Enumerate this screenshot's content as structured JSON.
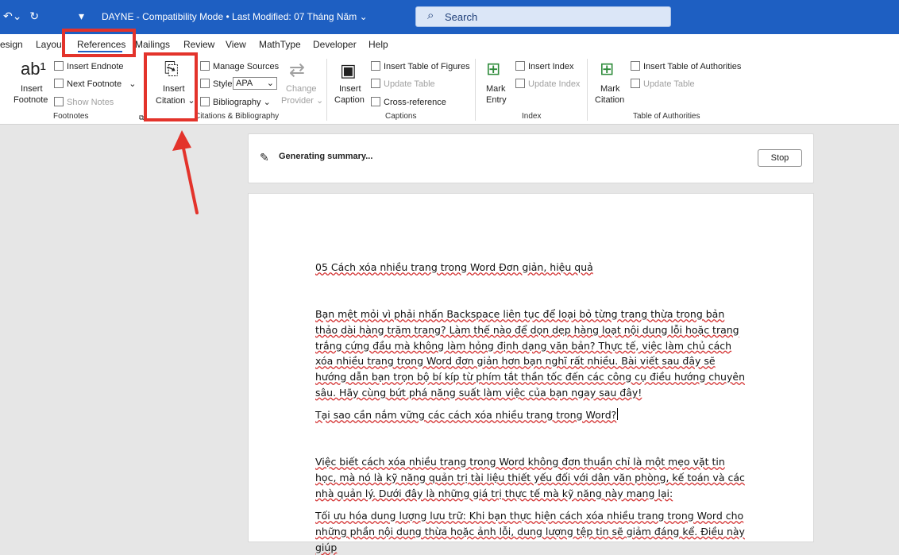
{
  "titlebar": {
    "title": "DAYNE  -  Compatibility Mode • Last Modified: 07 Tháng Năm ⌄",
    "search_placeholder": "Search",
    "undo": "↶⌄",
    "redo": "↻",
    "customize": "▾"
  },
  "tabs": [
    "esign",
    "Layout",
    "References",
    "Mailings",
    "Review",
    "View",
    "MathType",
    "Developer",
    "Help"
  ],
  "ribbon": {
    "footnotes": {
      "insert_footnote": "Insert\nFootnote",
      "insert_endnote": "Insert Endnote",
      "next_footnote": "Next Footnote",
      "show_notes": "Show Notes",
      "group": "Footnotes"
    },
    "citations": {
      "insert_citation_1": "Insert",
      "insert_citation_2": "Citation ⌄",
      "manage_sources": "Manage Sources",
      "style_label": "Style:",
      "style_value": "APA",
      "bibliography": "Bibliography ⌄",
      "change_provider_1": "Change",
      "change_provider_2": "Provider ⌄",
      "group": "Citations & Bibliography"
    },
    "captions": {
      "insert_caption_1": "Insert",
      "insert_caption_2": "Caption",
      "insert_tof": "Insert Table of Figures",
      "update_table": "Update Table",
      "cross_reference": "Cross-reference",
      "group": "Captions"
    },
    "index": {
      "mark_entry_1": "Mark",
      "mark_entry_2": "Entry",
      "insert_index": "Insert Index",
      "update_index": "Update Index",
      "group": "Index"
    },
    "toa": {
      "mark_citation_1": "Mark",
      "mark_citation_2": "Citation",
      "insert_toa": "Insert Table of Authorities",
      "update_table": "Update Table",
      "group": "Table of Authorities"
    }
  },
  "summary": {
    "text": "Generating summary...",
    "stop": "Stop"
  },
  "document": {
    "heading": "05 Cách xóa nhiều trang trong Word Đơn giản, hiệu quả",
    "p1": "Bạn mệt mỏi vì phải nhấn Backspace liên tục để loại bỏ từng trang thừa trong bản thảo dài hàng trăm trang? Làm thế nào để dọn dẹp hàng loạt nội dung lỗi hoặc trang trắng cứng đầu mà không làm hỏng định dạng văn bản? Thực tế, việc làm chủ cách xóa nhiều trang trong Word đơn giản hơn bạn nghĩ rất nhiều. Bài viết sau đây sẽ hướng dẫn bạn trọn bộ bí kíp từ phím tắt thần tốc đến các công cụ điều hướng chuyên sâu. Hãy cùng bứt phá năng suất làm việc của bạn ngay sau đây!",
    "p2": "Tại sao cần nắm vững các cách xóa nhiều trang trong Word?",
    "p3": "Việc biết cách xóa nhiều trang trong Word không đơn thuần chỉ là một mẹo vặt tin học, mà nó là kỹ năng quản trị tài liệu thiết yếu đối với dân văn phòng, kế toán và các nhà quản lý. Dưới đây là những giá trị thực tế mà kỹ năng này mang lại:",
    "p4": "Tối ưu hóa dung lượng lưu trữ: Khi bạn thực hiện cách xóa nhiều trang trong Word cho những phần nội dung thừa hoặc ảnh lỗi, dung lượng tệp tin sẽ giảm đáng kể. Điều này giúp"
  },
  "colors": {
    "titlebar": "#1e5fc2",
    "highlight": "#e3332b"
  }
}
